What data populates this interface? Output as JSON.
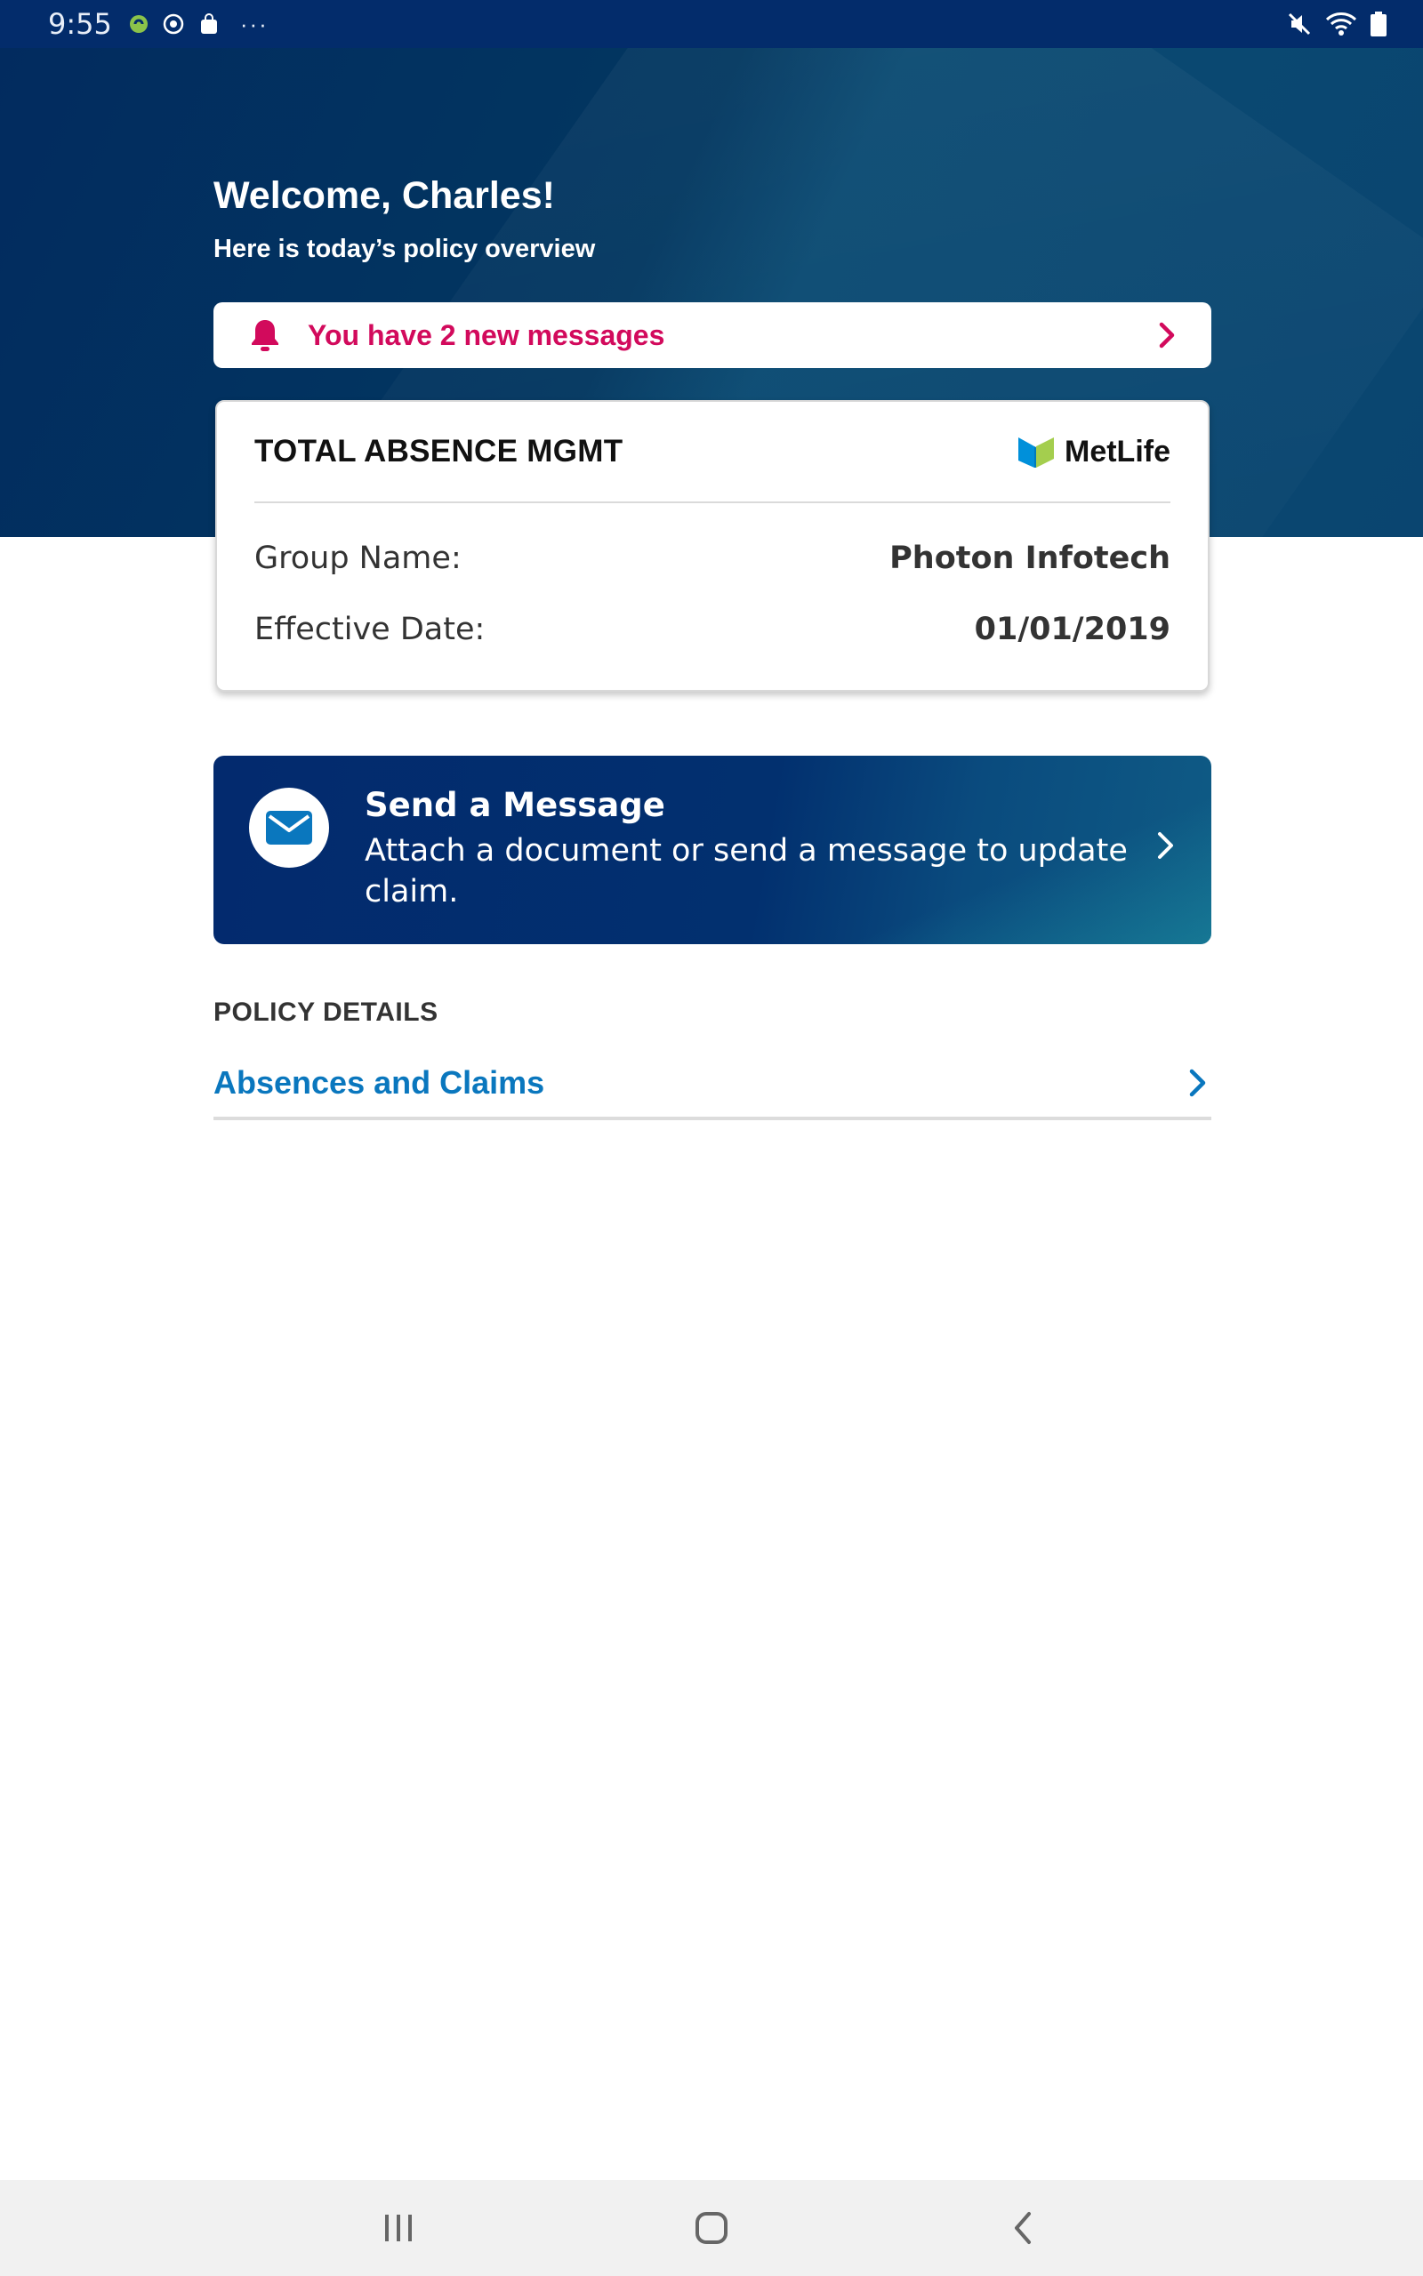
{
  "status_bar": {
    "time": "9:55",
    "more": "···",
    "left_icons": [
      "app-notification-icon",
      "sync-icon",
      "shopping-bag-icon"
    ],
    "right_icons": [
      "mute-icon",
      "wifi-icon",
      "battery-icon"
    ]
  },
  "hero": {
    "welcome": "Welcome, Charles!",
    "subtitle": "Here is today’s policy overview"
  },
  "messages_banner": {
    "text": "You have 2 new messages",
    "color": "#d20a5c"
  },
  "policy_card": {
    "title": "TOTAL ABSENCE MGMT",
    "brand": "MetLife",
    "rows": [
      {
        "label": "Group Name:",
        "value": "Photon Infotech"
      },
      {
        "label": "Effective Date:",
        "value": "01/01/2019"
      }
    ]
  },
  "send_message": {
    "title": "Send a Message",
    "description": "Attach a document or send a message to update claim."
  },
  "policy_details": {
    "section_title": "POLICY DETAILS",
    "links": [
      {
        "label": "Absences and Claims"
      }
    ]
  },
  "colors": {
    "primary_navy": "#022b5f",
    "link_blue": "#0a77be",
    "alert_pink": "#d20a5c"
  }
}
